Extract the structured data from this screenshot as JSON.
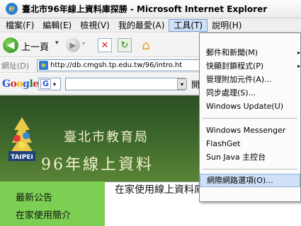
{
  "window": {
    "title": "臺北市96年線上資料庫探勝 - Microsoft Internet Explorer",
    "logo_letter": "e"
  },
  "menubar": {
    "items": [
      "檔案(F)",
      "編輯(E)",
      "檢視(V)",
      "我的最愛(A)",
      "工具(T)",
      "說明(H)"
    ],
    "active_index": 4
  },
  "toolbar": {
    "back_label": "上一頁",
    "dropdown_glyph": "▾"
  },
  "address": {
    "label": "網址(D)",
    "url": "http://db.cmgsh.tp.edu.tw/96/intro.ht"
  },
  "googlebar": {
    "logo_letters": [
      "G",
      "o",
      "o",
      "g",
      "l",
      "e"
    ],
    "button_letter": "G",
    "go_label": "開"
  },
  "banner": {
    "line1": "臺北市教育局",
    "line2": "96年線上資料",
    "logo_text": "TAIPEI"
  },
  "sidebar": {
    "items": [
      "最新公告",
      "在家使用簡介"
    ]
  },
  "content": {
    "title": "在家使用線上資料庫的設定說明"
  },
  "tools_menu": {
    "group1": [
      "郵件和新聞(M)",
      "快顯封鎖程式(P)",
      "管理附加元件(A)...",
      "同步處理(S)...",
      "Windows Update(U)"
    ],
    "group2": [
      "Windows Messenger",
      "FlashGet",
      "Sun Java 主控台"
    ],
    "group3": [
      "網際網路選項(O)..."
    ],
    "submenu_arrow": "▸"
  },
  "colors": {
    "banner": "#3f6a2c",
    "sidebar": "#7ccf53",
    "highlight": "#cfe0f7"
  }
}
